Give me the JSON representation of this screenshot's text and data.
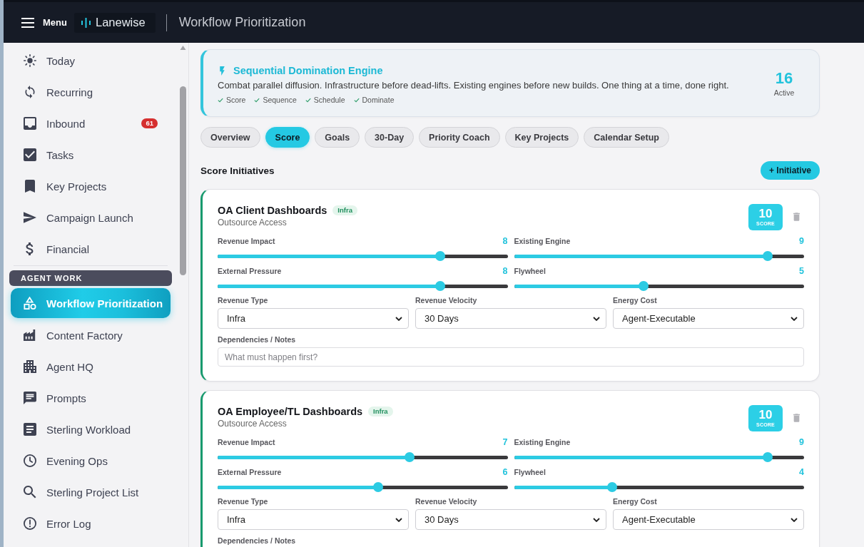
{
  "header": {
    "menu_label": "Menu",
    "logo": "Lanewise",
    "title": "Workflow Prioritization"
  },
  "sidebar": {
    "items": [
      {
        "label": "Today",
        "selected": false
      },
      {
        "label": "Recurring",
        "selected": false
      },
      {
        "label": "Inbound",
        "badge": "61",
        "selected": false
      },
      {
        "label": "Tasks",
        "selected": false
      },
      {
        "label": "Key Projects",
        "selected": false
      },
      {
        "label": "Campaign Launch",
        "selected": false
      },
      {
        "label": "Financial",
        "selected": false
      }
    ],
    "agent_work": {
      "heading": "AGENT WORK",
      "items": [
        {
          "label": "Workflow Prioritization",
          "selected": true
        },
        {
          "label": "Content Factory",
          "selected": false
        },
        {
          "label": "Agent HQ",
          "selected": false
        },
        {
          "label": "Prompts",
          "selected": false
        },
        {
          "label": "Sterling Workload",
          "selected": false
        },
        {
          "label": "Evening Ops",
          "selected": false
        },
        {
          "label": "Sterling Project List",
          "selected": false
        },
        {
          "label": "Error Log",
          "selected": false
        }
      ]
    }
  },
  "banner": {
    "title": "Sequential Domination Engine",
    "description": "Combat parallel diffusion. Infrastructure before dead-lifts. Existing engines before new builds. One thing at a time, done right.",
    "checks": [
      "Score",
      "Sequence",
      "Schedule",
      "Dominate"
    ],
    "count": "16",
    "count_label": "Active"
  },
  "tabs": [
    {
      "label": "Overview",
      "selected": false
    },
    {
      "label": "Score",
      "selected": true
    },
    {
      "label": "Goals",
      "selected": false
    },
    {
      "label": "30-Day",
      "selected": false
    },
    {
      "label": "Priority Coach",
      "selected": false
    },
    {
      "label": "Key Projects",
      "selected": false
    },
    {
      "label": "Calendar Setup",
      "selected": false
    }
  ],
  "section": {
    "title": "Score Initiatives",
    "add_button": "+ Initiative"
  },
  "initiatives": [
    {
      "title": "OA Client Dashboards",
      "tag": "Infra",
      "subtitle": "Outsource Access",
      "score": "10",
      "score_label": "SCORE",
      "sliders": [
        {
          "label": "Revenue Impact",
          "value": "8",
          "level": 0.778
        },
        {
          "label": "Existing Engine",
          "value": "9",
          "level": 0.889
        },
        {
          "label": "External Pressure",
          "value": "8",
          "level": 0.778
        },
        {
          "label": "Flywheel",
          "value": "5",
          "level": 0.444
        }
      ],
      "selects": [
        {
          "label": "Revenue Type",
          "value": "Infra"
        },
        {
          "label": "Revenue Velocity",
          "value": "30 Days"
        },
        {
          "label": "Energy Cost",
          "value": "Agent-Executable"
        }
      ],
      "notes": {
        "label": "Dependencies / Notes",
        "placeholder": "What must happen first?"
      }
    },
    {
      "title": "OA Employee/TL Dashboards",
      "tag": "Infra",
      "subtitle": "Outsource Access",
      "score": "10",
      "score_label": "SCORE",
      "sliders": [
        {
          "label": "Revenue Impact",
          "value": "7",
          "level": 0.667
        },
        {
          "label": "Existing Engine",
          "value": "9",
          "level": 0.889
        },
        {
          "label": "External Pressure",
          "value": "6",
          "level": 0.556
        },
        {
          "label": "Flywheel",
          "value": "4",
          "level": 0.333
        }
      ],
      "selects": [
        {
          "label": "Revenue Type",
          "value": "Infra"
        },
        {
          "label": "Revenue Velocity",
          "value": "30 Days"
        },
        {
          "label": "Energy Cost",
          "value": "Agent-Executable"
        }
      ],
      "notes": {
        "label": "Dependencies / Notes"
      }
    }
  ]
}
